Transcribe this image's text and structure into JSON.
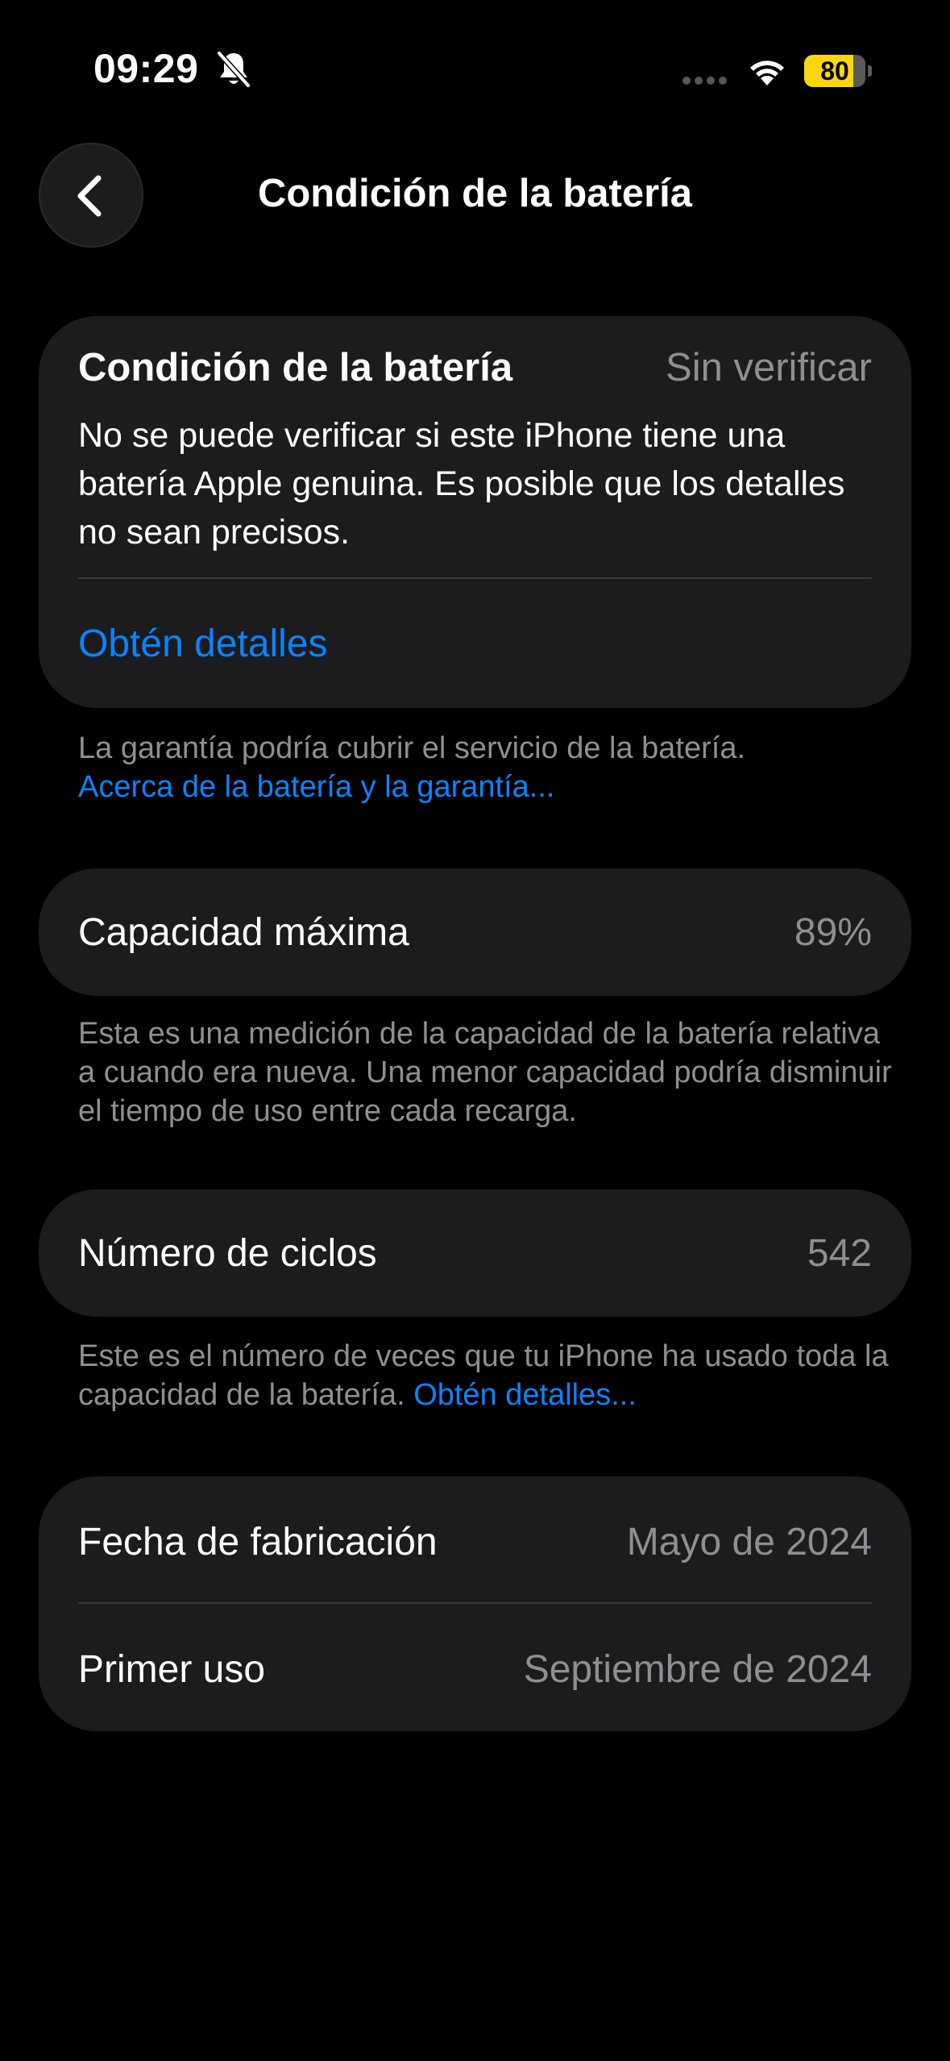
{
  "status_bar": {
    "time": "09:29",
    "battery_level": "80",
    "battery_fraction": 0.8,
    "accent_battery": "#ffd60a"
  },
  "nav": {
    "back_icon": "chevron-left-icon",
    "title": "Condición de la batería"
  },
  "health_card": {
    "title": "Condición de la batería",
    "status": "Sin verificar",
    "description": "No se puede verificar si este iPhone tiene una batería Apple genuina. Es posible que los detalles no sean precisos.",
    "link": "Obtén detalles"
  },
  "warranty_note": {
    "text": "La garantía podría cubrir el servicio de la batería.",
    "link": "Acerca de la batería y la garantía..."
  },
  "capacity": {
    "label": "Capacidad máxima",
    "value": "89%",
    "note": "Esta es una medición de la capacidad de la batería relativa a cuando era nueva. Una menor capacidad podría disminuir el tiempo de uso entre cada recarga."
  },
  "cycles": {
    "label": "Número de ciclos",
    "value": "542",
    "note": "Este es el número de veces que tu iPhone ha usado toda la capacidad de la batería.",
    "note_link": "Obtén detalles..."
  },
  "dates": {
    "manufacture_label": "Fecha de fabricación",
    "manufacture_value": "Mayo de 2024",
    "first_use_label": "Primer uso",
    "first_use_value": "Septiembre de 2024"
  },
  "colors": {
    "background": "#000000",
    "card": "#1c1c1e",
    "link": "#0a84ff",
    "secondary_text": "#8e8e93"
  }
}
